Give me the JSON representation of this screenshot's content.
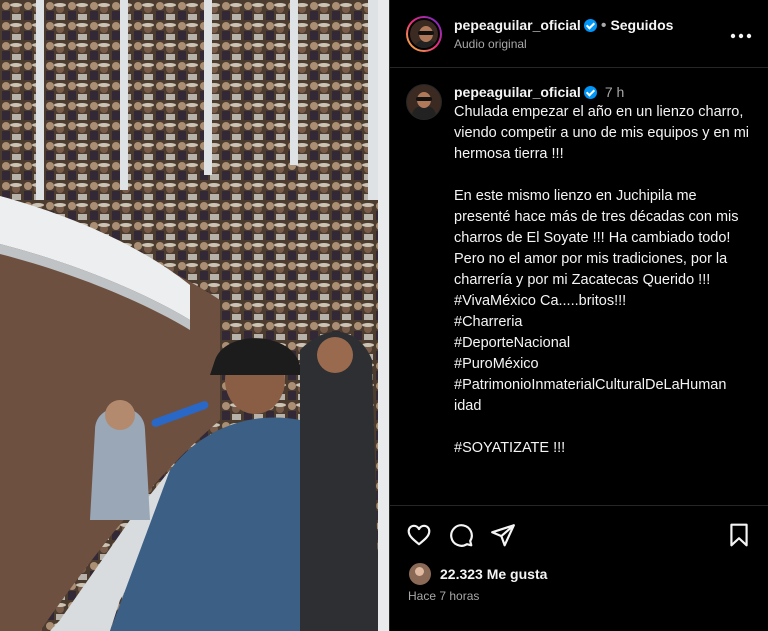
{
  "header": {
    "username": "pepeaguilar_oficial",
    "separator": "•",
    "follow_status": "Seguidos",
    "audio": "Audio original",
    "more_icon": "more-horizontal-icon"
  },
  "caption": {
    "username": "pepeaguilar_oficial",
    "time": "7 h",
    "text": "Chulada empezar el año en un lienzo charro, viendo competir a uno de mis equipos y en mi hermosa tierra !!!\n\nEn este mismo lienzo en Juchipila me presenté hace más de tres décadas con mis charros de El Soyate !!! Ha cambiado todo! Pero no el amor por mis tradiciones, por la charrería y por mi Zacatecas Querido !!!\n#VivaMéxico Ca.....britos!!!\n#Charreria\n#DeporteNacional\n#PuroMéxico\n#PatrimonioInmaterialCulturalDeLaHuman idad\n\n#SOYATIZATE !!!"
  },
  "actions": {
    "icons": [
      "heart-icon",
      "comment-icon",
      "share-icon",
      "save-icon"
    ]
  },
  "likes": "22.323 Me gusta",
  "posted": "Hace 7 horas",
  "colors": {
    "background": "#000000",
    "text": "#f5f5f5",
    "muted": "#a8a8a8",
    "verified": "#0095f6",
    "divider": "#262626"
  }
}
